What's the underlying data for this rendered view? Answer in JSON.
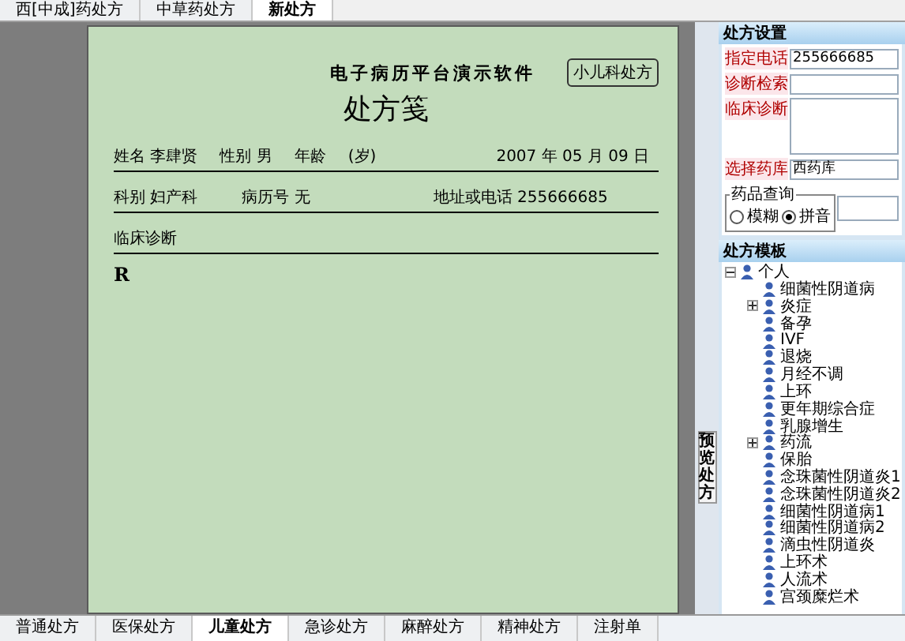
{
  "top_tabs": [
    {
      "label": "西[中成]药处方",
      "selected": false
    },
    {
      "label": "中草药处方",
      "selected": false
    },
    {
      "label": "新处方",
      "selected": true
    }
  ],
  "prescription": {
    "software_title": "电子病历平台演示软件",
    "type_button": "小儿科处方",
    "title": "处方笺",
    "row1": [
      {
        "label": "姓名",
        "value": "李肆贤"
      },
      {
        "label": "性别",
        "value": "男"
      },
      {
        "label": "年龄"
      },
      {
        "label": "(岁)"
      },
      {
        "label": "2007 年 05 月 09 日"
      }
    ],
    "row2": [
      {
        "label": "科别",
        "value": "妇产科"
      },
      {
        "label": "病历号",
        "value": "无"
      },
      {
        "label": "地址或电话",
        "value": "255666685"
      }
    ],
    "diagnosis_label": "临床诊断",
    "rx": "R"
  },
  "side_tab": "预览处方",
  "settings": {
    "title": "处方设置",
    "phone_label": "指定电话",
    "phone": "255666685",
    "search_label": "诊断检索",
    "diagnosis_label": "临床诊断",
    "pharmacy_label": "选择药库",
    "pharmacy": "西药库",
    "query": {
      "title": "药品查询",
      "options": [
        {
          "label": "模糊",
          "selected": false
        },
        {
          "label": "拼音",
          "selected": true
        }
      ]
    }
  },
  "templates": {
    "title": "处方模板",
    "tree": [
      {
        "label": "个人",
        "expanded": true,
        "children": [
          {
            "label": "细菌性阴道病"
          },
          {
            "label": "炎症",
            "expanded": false
          },
          {
            "label": "备孕"
          },
          {
            "label": "IVF"
          },
          {
            "label": "退烧"
          },
          {
            "label": "月经不调"
          },
          {
            "label": "上环"
          },
          {
            "label": "更年期综合症"
          },
          {
            "label": "乳腺增生"
          },
          {
            "label": "药流",
            "expanded": false
          },
          {
            "label": "保胎"
          },
          {
            "label": "念珠菌性阴道炎1"
          },
          {
            "label": "念珠菌性阴道炎2"
          },
          {
            "label": "细菌性阴道病1"
          },
          {
            "label": "细菌性阴道病2"
          },
          {
            "label": "滴虫性阴道炎"
          },
          {
            "label": "上环术"
          },
          {
            "label": "人流术"
          },
          {
            "label": "宫颈糜烂术"
          }
        ]
      }
    ]
  },
  "bottom_tabs": [
    {
      "label": "普通处方",
      "selected": false
    },
    {
      "label": "医保处方",
      "selected": false
    },
    {
      "label": "儿童处方",
      "selected": true
    },
    {
      "label": "急诊处方",
      "selected": false
    },
    {
      "label": "麻醉处方",
      "selected": false
    },
    {
      "label": "精神处方",
      "selected": false
    },
    {
      "label": "注射单",
      "selected": false
    }
  ]
}
